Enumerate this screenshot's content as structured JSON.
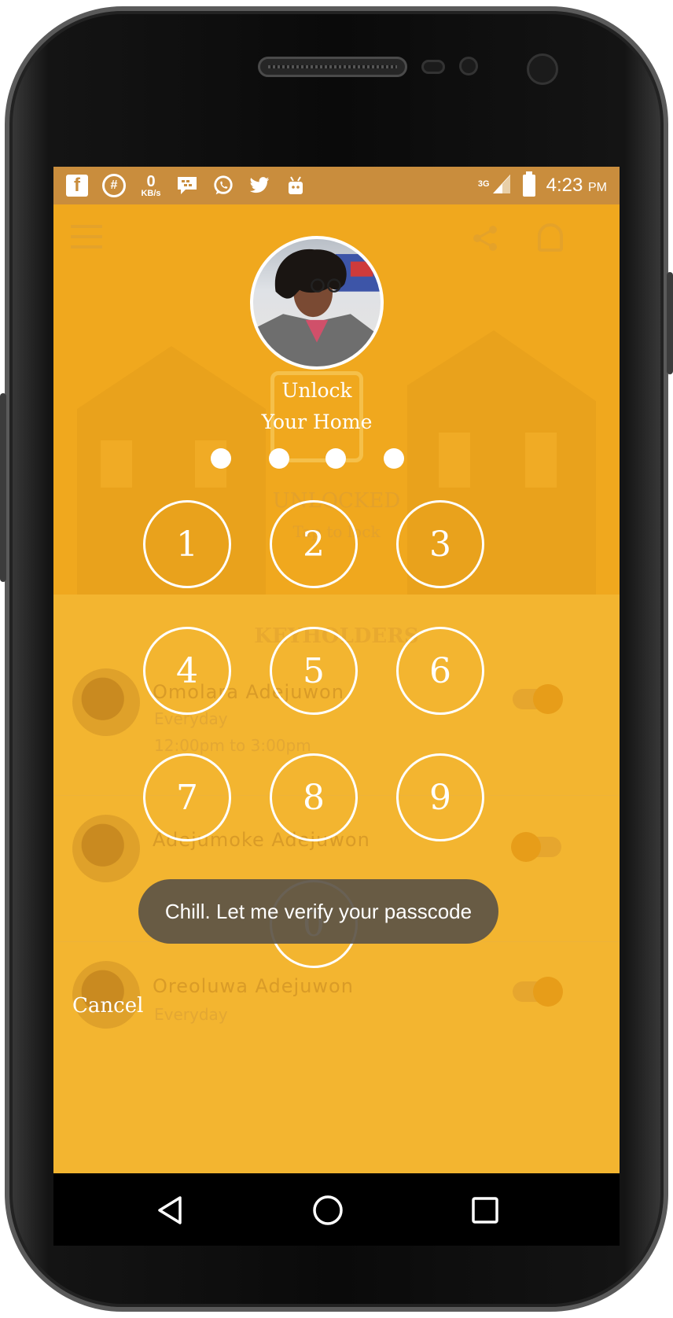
{
  "status_bar": {
    "kb_value": "0",
    "kb_unit": "KB/s",
    "network": "3G",
    "time": "4:23",
    "time_suffix": "PM",
    "icons": [
      "facebook-icon",
      "hashtag-icon",
      "bbm-icon",
      "whatsapp-icon",
      "twitter-icon",
      "android-icon",
      "signal-icon",
      "battery-icon"
    ]
  },
  "background_app": {
    "status": "UNLOCKED",
    "status_hint": "Tap to lock",
    "section_title": "KEYHOLDERS",
    "keyholders": [
      {
        "name": "Omolara Adejuwon",
        "schedule": "Everyday",
        "time": "12:00pm to 3:00pm"
      },
      {
        "name": "Adejumoke Adejuwon",
        "schedule": "",
        "time": ""
      },
      {
        "name": "Oreoluwa Adejuwon",
        "schedule": "Everyday",
        "time": ""
      }
    ]
  },
  "lock_screen": {
    "title_line1": "Unlock",
    "title_line2": "Your Home",
    "passcode_length": 4,
    "keys": [
      "1",
      "2",
      "3",
      "4",
      "5",
      "6",
      "7",
      "8",
      "9",
      "0"
    ],
    "cancel_label": "Cancel",
    "toast_message": "Chill. Let me verify your passcode"
  },
  "colors": {
    "accent": "#f1ab12",
    "status_bar": "#c98d3d",
    "toast": "#5c5446"
  }
}
